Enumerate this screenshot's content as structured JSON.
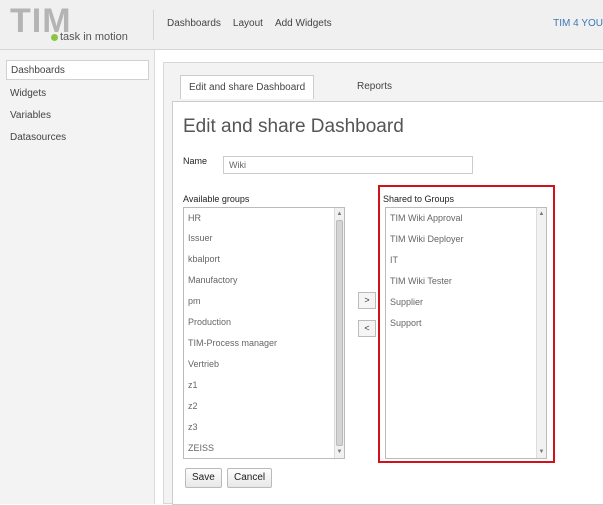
{
  "header": {
    "logo_text": "TIM",
    "logo_subtitle": "task in motion",
    "nav": [
      "Dashboards",
      "Layout",
      "Add Widgets"
    ],
    "user": "TIM 4 YOU"
  },
  "sidebar": {
    "items": [
      "Dashboards",
      "Widgets",
      "Variables",
      "Datasources"
    ]
  },
  "tabs": [
    "Edit and share Dashboard",
    "Reports"
  ],
  "form": {
    "title": "Edit and share Dashboard",
    "name_label": "Name",
    "name_value": "Wiki",
    "available_label": "Available groups",
    "shared_label": "Shared to Groups",
    "available_groups": [
      "HR",
      "Issuer",
      "kbalport",
      "Manufactory",
      "pm",
      "Production",
      "TIM-Process manager",
      "Vertrieb",
      "z1",
      "z2",
      "z3",
      "ZEISS"
    ],
    "shared_groups": [
      "TIM Wiki Approval",
      "TIM Wiki Deployer",
      "IT",
      "TIM Wiki Tester",
      "Supplier",
      "Support"
    ],
    "move_right": ">",
    "move_left": "<",
    "save": "Save",
    "cancel": "Cancel"
  },
  "colors": {
    "highlight": "#d0121b",
    "logo_dot": "#8cc63f",
    "user_link": "#3a78b5"
  }
}
